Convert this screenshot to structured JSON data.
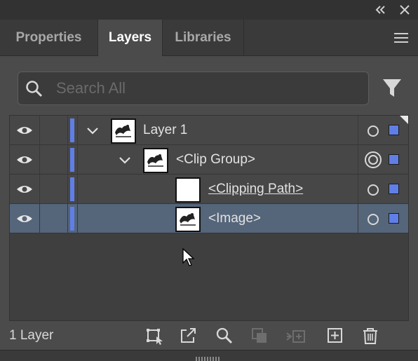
{
  "window": {
    "collapse_icon": "double-chevron-left-icon",
    "close_icon": "close-icon"
  },
  "tabs": [
    {
      "label": "Properties",
      "active": false
    },
    {
      "label": "Layers",
      "active": true
    },
    {
      "label": "Libraries",
      "active": false
    }
  ],
  "panel_menu_icon": "hamburger-menu-icon",
  "search": {
    "placeholder": "Search All",
    "value": "",
    "icon": "search-icon"
  },
  "filter_icon": "filter-icon",
  "layers": [
    {
      "label": "Layer 1",
      "visible": true,
      "expanded": true,
      "thumbnail": "artwork",
      "target": "single",
      "selected": false
    },
    {
      "label": "<Clip Group>",
      "visible": true,
      "expanded": true,
      "thumbnail": "artwork",
      "target": "double",
      "selected": false
    },
    {
      "label": "<Clipping Path>",
      "visible": true,
      "expanded": false,
      "thumbnail": "blank",
      "target": "single",
      "selected": false
    },
    {
      "label": "<Image>",
      "visible": true,
      "expanded": false,
      "thumbnail": "artwork",
      "target": "single",
      "selected": true
    }
  ],
  "layer_color": "#5f7fe6",
  "selection_row_color": "#55657a",
  "footer": {
    "layer_count": "1 Layer",
    "buttons": [
      "collect-for-export-icon",
      "export-icon",
      "locate-object-icon",
      "make-clipping-mask-icon",
      "create-sublayer-icon",
      "create-new-layer-icon",
      "delete-icon"
    ]
  }
}
